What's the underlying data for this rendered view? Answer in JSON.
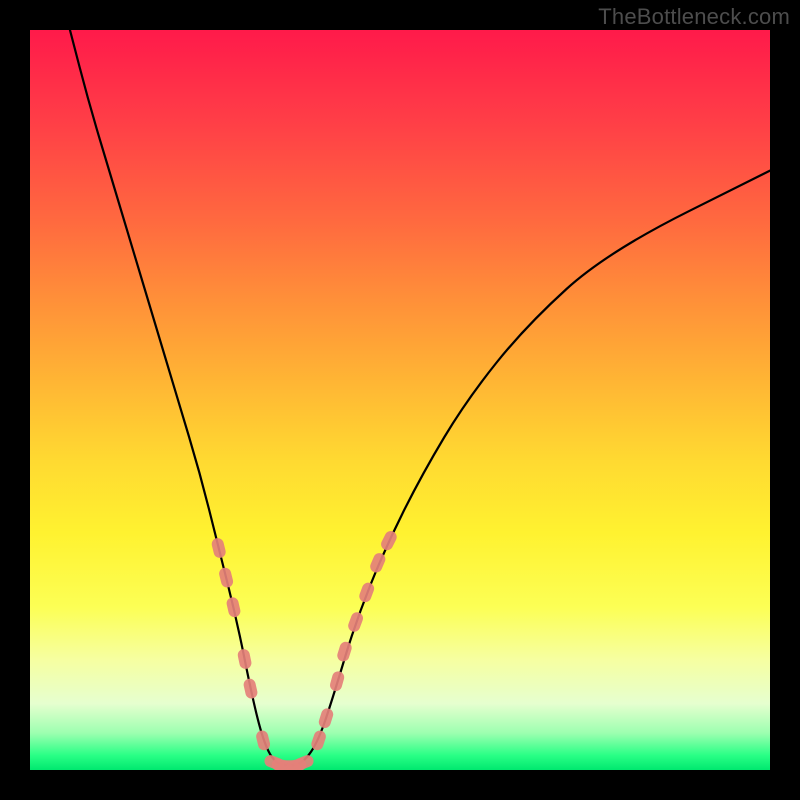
{
  "watermark": "TheBottleneck.com",
  "chart_data": {
    "type": "line",
    "title": "",
    "xlabel": "",
    "ylabel": "",
    "xlim": [
      0,
      100
    ],
    "ylim": [
      0,
      100
    ],
    "grid": false,
    "background": {
      "style": "vertical-gradient",
      "stops": [
        {
          "pos": 0,
          "color": "#ff1a4a"
        },
        {
          "pos": 12,
          "color": "#ff3d47"
        },
        {
          "pos": 26,
          "color": "#ff6a3f"
        },
        {
          "pos": 36,
          "color": "#ff8e39"
        },
        {
          "pos": 48,
          "color": "#ffb734"
        },
        {
          "pos": 58,
          "color": "#ffd931"
        },
        {
          "pos": 68,
          "color": "#fff230"
        },
        {
          "pos": 78,
          "color": "#fcff55"
        },
        {
          "pos": 85,
          "color": "#f6ffa0"
        },
        {
          "pos": 91,
          "color": "#e6ffcf"
        },
        {
          "pos": 95,
          "color": "#9dffb0"
        },
        {
          "pos": 98,
          "color": "#2aff86"
        },
        {
          "pos": 100,
          "color": "#00e86f"
        }
      ]
    },
    "series": [
      {
        "name": "bottleneck-curve",
        "color": "#000000",
        "points": [
          {
            "x": 5.4,
            "y": 100
          },
          {
            "x": 8,
            "y": 90
          },
          {
            "x": 11,
            "y": 80
          },
          {
            "x": 14,
            "y": 70
          },
          {
            "x": 17,
            "y": 60
          },
          {
            "x": 20,
            "y": 50
          },
          {
            "x": 23,
            "y": 40
          },
          {
            "x": 25.5,
            "y": 30
          },
          {
            "x": 28,
            "y": 20
          },
          {
            "x": 30,
            "y": 10
          },
          {
            "x": 31.5,
            "y": 4
          },
          {
            "x": 33,
            "y": 1
          },
          {
            "x": 35,
            "y": 0.5
          },
          {
            "x": 37,
            "y": 1
          },
          {
            "x": 39,
            "y": 4
          },
          {
            "x": 41,
            "y": 10
          },
          {
            "x": 44,
            "y": 20
          },
          {
            "x": 48,
            "y": 30
          },
          {
            "x": 53,
            "y": 40
          },
          {
            "x": 59,
            "y": 50
          },
          {
            "x": 67,
            "y": 60
          },
          {
            "x": 78,
            "y": 70
          },
          {
            "x": 100,
            "y": 81
          }
        ]
      },
      {
        "name": "highlight-left-dots",
        "color": "#e48079",
        "style": "lozenge",
        "points": [
          {
            "x": 25.5,
            "y": 30
          },
          {
            "x": 26.5,
            "y": 26
          },
          {
            "x": 27.5,
            "y": 22
          },
          {
            "x": 29.0,
            "y": 15
          },
          {
            "x": 29.8,
            "y": 11
          },
          {
            "x": 31.5,
            "y": 4
          }
        ]
      },
      {
        "name": "highlight-bottom-dots",
        "color": "#e48079",
        "style": "lozenge",
        "points": [
          {
            "x": 33.0,
            "y": 1
          },
          {
            "x": 34.0,
            "y": 0.6
          },
          {
            "x": 35.0,
            "y": 0.5
          },
          {
            "x": 36.0,
            "y": 0.6
          },
          {
            "x": 37.0,
            "y": 1
          }
        ]
      },
      {
        "name": "highlight-right-dots",
        "color": "#e48079",
        "style": "lozenge",
        "points": [
          {
            "x": 39.0,
            "y": 4
          },
          {
            "x": 40.0,
            "y": 7
          },
          {
            "x": 41.5,
            "y": 12
          },
          {
            "x": 42.5,
            "y": 16
          },
          {
            "x": 44.0,
            "y": 20
          },
          {
            "x": 45.5,
            "y": 24
          },
          {
            "x": 47.0,
            "y": 28
          },
          {
            "x": 48.5,
            "y": 31
          }
        ]
      }
    ]
  }
}
